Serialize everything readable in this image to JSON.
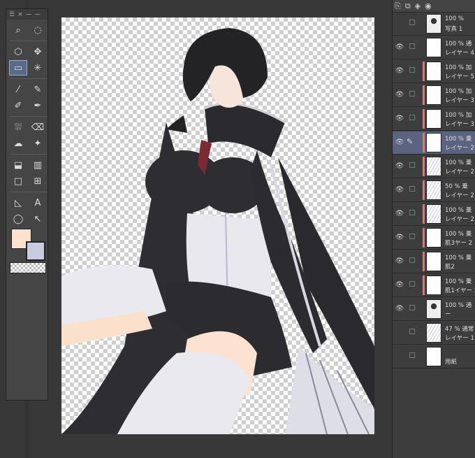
{
  "toolbox": {
    "header_close": "×",
    "header_minus": "ー",
    "header_lines": "ー"
  },
  "colors": {
    "main": "#fde3cf",
    "sub": "#c9c9e0",
    "selection_highlight": "#5a6480",
    "clip_marker": "#d47a7a"
  },
  "tools": [
    {
      "icon": "zoom-icon",
      "glyph": "⌕"
    },
    {
      "icon": "rotate-view-icon",
      "glyph": "◌"
    },
    {
      "icon": "object-icon",
      "glyph": "⬡"
    },
    {
      "icon": "move-icon",
      "glyph": "✥"
    },
    {
      "icon": "selection-rect-icon",
      "glyph": "▭",
      "active": true
    },
    {
      "icon": "magic-wand-icon",
      "glyph": "✳"
    },
    {
      "icon": "eyedropper-icon",
      "glyph": "⁄"
    },
    {
      "icon": "pen-icon",
      "glyph": "✎"
    },
    {
      "icon": "pencil-icon",
      "glyph": "✐"
    },
    {
      "icon": "brush-icon",
      "glyph": "✒"
    },
    {
      "icon": "airbrush-icon",
      "glyph": "⛆"
    },
    {
      "icon": "eraser-icon",
      "glyph": "⌫"
    },
    {
      "icon": "blend-icon",
      "glyph": "☁"
    },
    {
      "icon": "decoration-icon",
      "glyph": "✦"
    },
    {
      "icon": "fill-icon",
      "glyph": "⬓"
    },
    {
      "icon": "gradient-icon",
      "glyph": "▥"
    },
    {
      "icon": "figure-icon",
      "glyph": "□"
    },
    {
      "icon": "frame-icon",
      "glyph": "⊞"
    },
    {
      "icon": "ruler-icon",
      "glyph": "◺"
    },
    {
      "icon": "text-icon",
      "glyph": "A"
    },
    {
      "icon": "balloon-icon",
      "glyph": "◯"
    },
    {
      "icon": "correct-line-icon",
      "glyph": "↖"
    }
  ],
  "layers": [
    {
      "line1": "100 %",
      "line2": "写真 1",
      "visible": false,
      "thumb": "figure"
    },
    {
      "line1": "100 % 通",
      "line2": "レイヤー 4",
      "visible": true,
      "thumb": "blank"
    },
    {
      "line1": "100 % 加",
      "line2": "レイヤー 5",
      "visible": true,
      "clip": true,
      "thumb": "blank"
    },
    {
      "line1": "100 % 加",
      "line2": "レイヤー 3",
      "visible": true,
      "clip": true,
      "thumb": "blank"
    },
    {
      "line1": "100 % 加",
      "line2": "レイヤー 3",
      "visible": true,
      "clip": true,
      "thumb": "blank"
    },
    {
      "line1": "100 % 乗",
      "line2": "レイヤー 2",
      "visible": true,
      "clip": true,
      "thumb": "blank",
      "selected": true,
      "edit": true
    },
    {
      "line1": "100 % 乗",
      "line2": "レイヤー 2",
      "visible": true,
      "clip": true,
      "thumb": "sketch"
    },
    {
      "line1": "50 % 乗",
      "line2": "レイヤー 2",
      "visible": true,
      "clip": true,
      "thumb": "sketch"
    },
    {
      "line1": "100 % 乗",
      "line2": "レイヤー 2",
      "visible": true,
      "clip": true,
      "thumb": "sketch"
    },
    {
      "line1": "100 % 乗",
      "line2": "肌3ヤー 2",
      "visible": true,
      "clip": true,
      "thumb": "blank"
    },
    {
      "line1": "100 % 乗",
      "line2": "肌2",
      "visible": true,
      "clip": true,
      "thumb": "blank"
    },
    {
      "line1": "100 % 乗",
      "line2": "肌1イヤー 2",
      "visible": true,
      "clip": true,
      "thumb": "blank"
    },
    {
      "line1": "100 % 通",
      "line2": "ー",
      "visible": true,
      "thumb": "figure"
    },
    {
      "line1": "47 % 通常",
      "line2": "レイヤー 1",
      "visible": false,
      "thumb": "sketch"
    },
    {
      "line1": "",
      "line2": "用紙",
      "visible": false,
      "thumb": "paper"
    }
  ]
}
